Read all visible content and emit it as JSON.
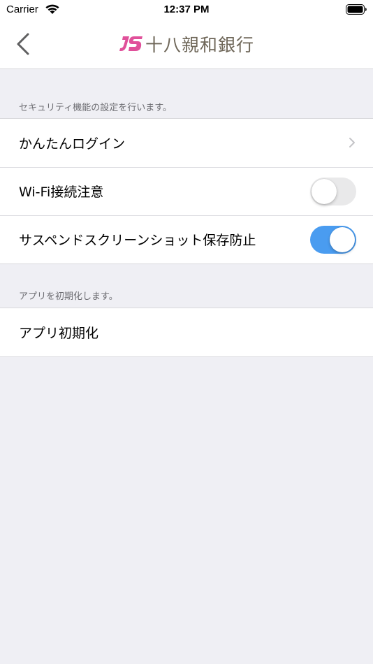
{
  "status_bar": {
    "carrier": "Carrier",
    "time": "12:37 PM"
  },
  "nav": {
    "back_icon": "chevron-left-icon",
    "logo_mark": "JS",
    "logo_text": "十八親和銀行",
    "logo_mark_color": "#e0509a",
    "logo_text_color": "#6e6658"
  },
  "security_section": {
    "header": "セキュリティ機能の設定を行います。",
    "items": [
      {
        "label": "かんたんログイン",
        "control": "disclosure"
      },
      {
        "label": "Wi-Fi接続注意",
        "control": "toggle",
        "on": false
      },
      {
        "label": "サスペンドスクリーンショット保存防止",
        "control": "toggle",
        "on": true
      }
    ]
  },
  "reset_section": {
    "header": "アプリを初期化します。",
    "items": [
      {
        "label": "アプリ初期化"
      }
    ]
  },
  "colors": {
    "background": "#efeff4",
    "toggle_on": "#4a9cf0",
    "toggle_off": "#e9e9ea",
    "section_header": "#6d6d72"
  }
}
